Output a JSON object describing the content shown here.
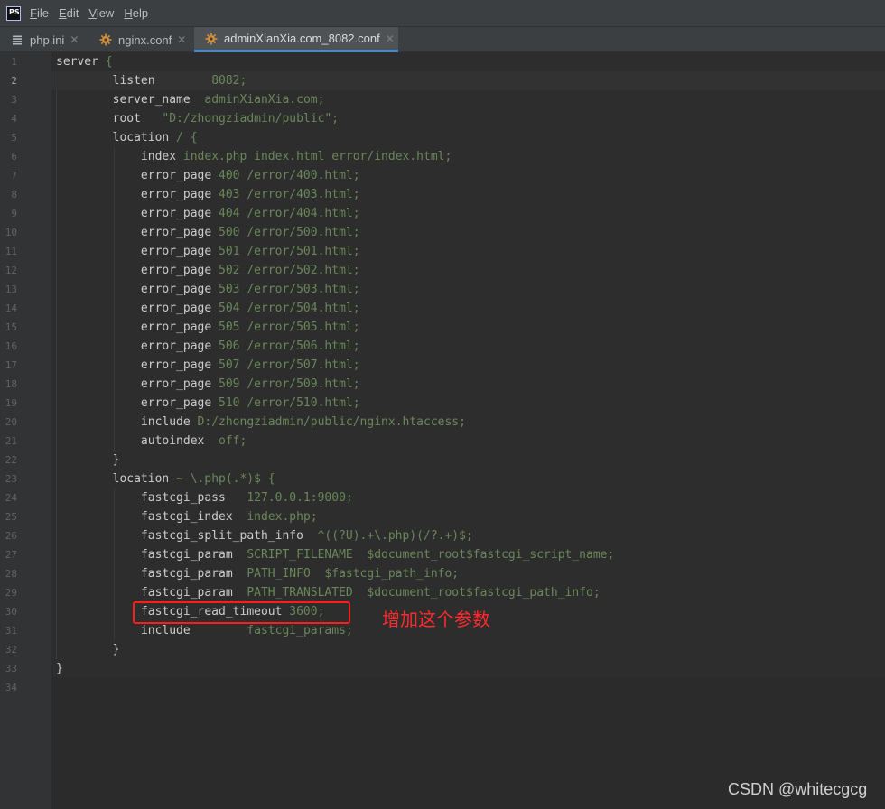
{
  "menu": {
    "logo": "PS",
    "items": [
      {
        "label": "File",
        "mnemonic": "F",
        "rest": "ile"
      },
      {
        "label": "Edit",
        "mnemonic": "E",
        "rest": "dit"
      },
      {
        "label": "View",
        "mnemonic": "V",
        "rest": "iew"
      },
      {
        "label": "Help",
        "mnemonic": "H",
        "rest": "elp"
      }
    ]
  },
  "tabs": [
    {
      "label": "php.ini",
      "icon": "text-file-icon",
      "active": false
    },
    {
      "label": "nginx.conf",
      "icon": "config-file-icon",
      "active": false
    },
    {
      "label": "adminXianXia.com_8082.conf",
      "icon": "config-file-icon",
      "active": true
    }
  ],
  "colors": {
    "accent": "#4a88c7",
    "directive": "#cccccc",
    "value": "#6a8759",
    "annotation": "#ff2a2a"
  },
  "editor": {
    "current_line": 2,
    "lines": [
      [
        [
          "server",
          "k"
        ],
        [
          " {",
          "v"
        ]
      ],
      [
        [
          "        listen",
          "k"
        ],
        [
          "        8082;",
          "v"
        ]
      ],
      [
        [
          "        server_name",
          "k"
        ],
        [
          "  adminXianXia.com;",
          "v"
        ]
      ],
      [
        [
          "        root",
          "k"
        ],
        [
          "   \"D:/zhongziadmin/public\";",
          "v"
        ]
      ],
      [
        [
          "        location",
          "k"
        ],
        [
          " / {",
          "v"
        ]
      ],
      [
        [
          "            index",
          "k"
        ],
        [
          " index.php index.html error/index.html;",
          "v"
        ]
      ],
      [
        [
          "            error_page",
          "k"
        ],
        [
          " 400 /error/400.html;",
          "v"
        ]
      ],
      [
        [
          "            error_page",
          "k"
        ],
        [
          " 403 /error/403.html;",
          "v"
        ]
      ],
      [
        [
          "            error_page",
          "k"
        ],
        [
          " 404 /error/404.html;",
          "v"
        ]
      ],
      [
        [
          "            error_page",
          "k"
        ],
        [
          " 500 /error/500.html;",
          "v"
        ]
      ],
      [
        [
          "            error_page",
          "k"
        ],
        [
          " 501 /error/501.html;",
          "v"
        ]
      ],
      [
        [
          "            error_page",
          "k"
        ],
        [
          " 502 /error/502.html;",
          "v"
        ]
      ],
      [
        [
          "            error_page",
          "k"
        ],
        [
          " 503 /error/503.html;",
          "v"
        ]
      ],
      [
        [
          "            error_page",
          "k"
        ],
        [
          " 504 /error/504.html;",
          "v"
        ]
      ],
      [
        [
          "            error_page",
          "k"
        ],
        [
          " 505 /error/505.html;",
          "v"
        ]
      ],
      [
        [
          "            error_page",
          "k"
        ],
        [
          " 506 /error/506.html;",
          "v"
        ]
      ],
      [
        [
          "            error_page",
          "k"
        ],
        [
          " 507 /error/507.html;",
          "v"
        ]
      ],
      [
        [
          "            error_page",
          "k"
        ],
        [
          " 509 /error/509.html;",
          "v"
        ]
      ],
      [
        [
          "            error_page",
          "k"
        ],
        [
          " 510 /error/510.html;",
          "v"
        ]
      ],
      [
        [
          "            include",
          "k"
        ],
        [
          " D:/zhongziadmin/public/nginx.htaccess;",
          "v"
        ]
      ],
      [
        [
          "            autoindex",
          "k"
        ],
        [
          "  off;",
          "v"
        ]
      ],
      [
        [
          "        }",
          "k"
        ]
      ],
      [
        [
          "        location",
          "k"
        ],
        [
          " ~ \\.php(.*)$ {",
          "v"
        ]
      ],
      [
        [
          "            fastcgi_pass",
          "k"
        ],
        [
          "   127.0.0.1:9000;",
          "v"
        ]
      ],
      [
        [
          "            fastcgi_index",
          "k"
        ],
        [
          "  index.php;",
          "v"
        ]
      ],
      [
        [
          "            fastcgi_split_path_info",
          "k"
        ],
        [
          "  ^((?U).+\\.php)(/?.+)$;",
          "v"
        ]
      ],
      [
        [
          "            fastcgi_param",
          "k"
        ],
        [
          "  SCRIPT_FILENAME  $document_root$fastcgi_script_name;",
          "v"
        ]
      ],
      [
        [
          "            fastcgi_param",
          "k"
        ],
        [
          "  PATH_INFO  $fastcgi_path_info;",
          "v"
        ]
      ],
      [
        [
          "            fastcgi_param",
          "k"
        ],
        [
          "  PATH_TRANSLATED  $document_root$fastcgi_path_info;",
          "v"
        ]
      ],
      [
        [
          "            fastcgi_read_timeout",
          "k"
        ],
        [
          " 3600;",
          "v"
        ]
      ],
      [
        [
          "            include",
          "k"
        ],
        [
          "        fastcgi_params;",
          "v"
        ]
      ],
      [
        [
          "        }",
          "k"
        ]
      ],
      [
        [
          "}",
          "k"
        ]
      ],
      []
    ]
  },
  "annotation": {
    "text": "增加这个参数",
    "highlighted_line": 30
  },
  "watermark": "CSDN @whitecgcg"
}
